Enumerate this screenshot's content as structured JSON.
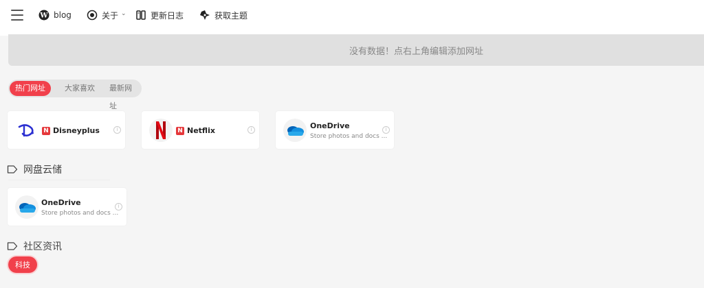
{
  "nav": {
    "blog": "blog",
    "about": "关于",
    "changelog": "更新日志",
    "get_theme": "获取主题"
  },
  "notice": "没有数据！点右上角编辑添加网址",
  "tabs": [
    "热门网址",
    "大家喜欢",
    "最新网址"
  ],
  "hot_cards": [
    {
      "title": "Disneyplus",
      "badge": "N",
      "description": ""
    },
    {
      "title": "Netflix",
      "badge": "N",
      "description": ""
    },
    {
      "title": "OneDrive",
      "badge": "",
      "description": "Store photos and docs ..."
    }
  ],
  "sections": [
    {
      "title": "网盘云储",
      "cards": [
        {
          "title": "OneDrive",
          "description": "Store photos and docs ..."
        }
      ]
    },
    {
      "title": "社区资讯",
      "tags": [
        "科技"
      ]
    }
  ],
  "colors": {
    "accent": "#f1404b",
    "netflix": "#e50914",
    "disney": "#2b2fd1",
    "onedrive": "#1490df"
  }
}
